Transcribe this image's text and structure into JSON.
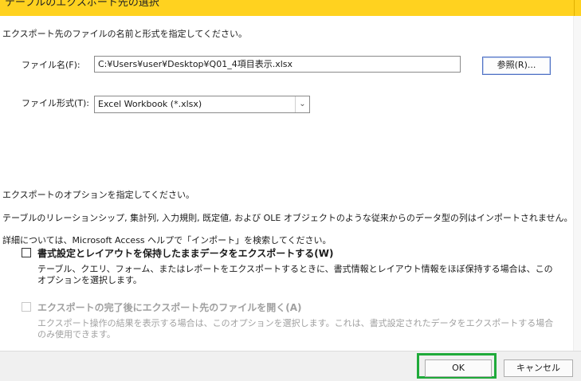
{
  "window": {
    "title": "テーブルのエクスポート先の選択"
  },
  "dialog": {
    "intro": "エクスポート先のファイルの名前と形式を指定してください。",
    "filename_label": "ファイル名(F):",
    "filename_value": "C:¥Users¥user¥Desktop¥Q01_4項目表示.xlsx",
    "browse_label": "参照(R)...",
    "format_label": "ファイル形式(T):",
    "format_value": "Excel Workbook (*.xlsx)",
    "options_intro": "エクスポートのオプションを指定してください。",
    "options_line2": "テーブルのリレーションシップ, 集計列, 入力規則, 既定値, および OLE オブジェクトのような従来からのデータ型の列はインポートされません。",
    "options_line3": "詳細については、Microsoft Access ヘルプで「インポート」を検索してください。",
    "option1_label": "書式設定とレイアウトを保持したままデータをエクスポートする(W)",
    "option1_desc": "テーブル、クエリ、フォーム、またはレポートをエクスポートするときに、書式情報とレイアウト情報をほぼ保持する場合は、このオプションを選択します。",
    "option2_label": "エクスポートの完了後にエクスポート先のファイルを開く(A)",
    "option2_desc": "エクスポート操作の結果を表示する場合は、このオプションを選択します。これは、書式設定されたデータをエクスポートする場合のみ使用できます。"
  },
  "footer": {
    "ok_label": "OK",
    "cancel_label": "キャンセル"
  },
  "colors": {
    "titlebar": "#ffd21f",
    "highlight": "#1faa3a",
    "focus_border": "#4f71c4"
  }
}
